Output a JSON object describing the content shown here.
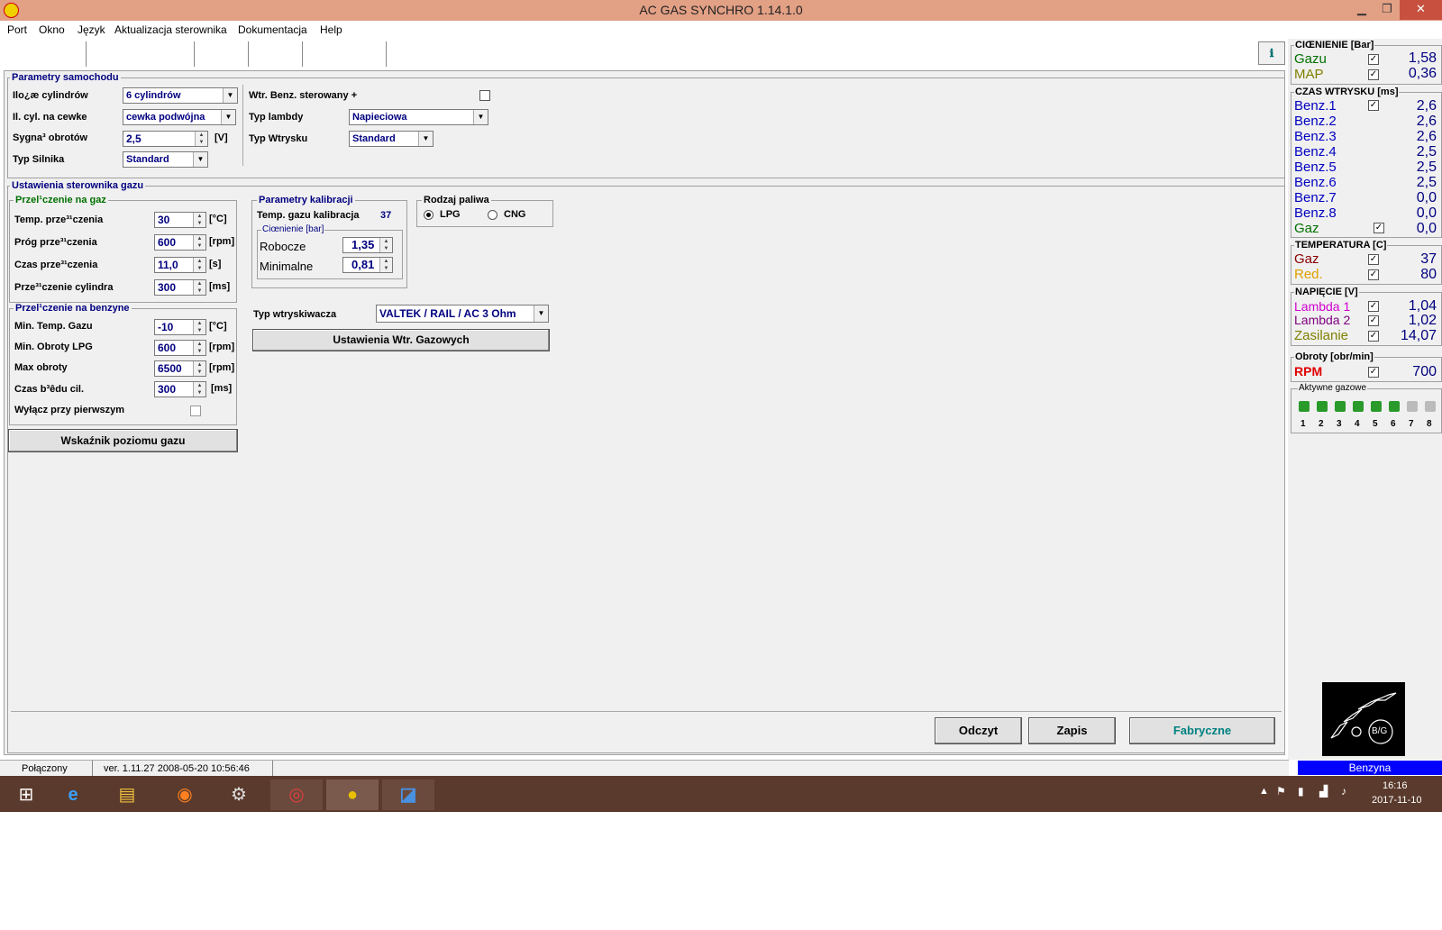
{
  "window": {
    "title": "AC GAS SYNCHRO     1.14.1.0",
    "minimize": "▁",
    "restore": "❐",
    "close": "✕"
  },
  "menu": [
    "Port",
    "Okno",
    "Język",
    "Aktualizacja sterownika",
    "Dokumentacja",
    "Help"
  ],
  "toolbar": {
    "help_icon": "ℹ"
  },
  "car_params": {
    "title": "Parametry samochodu",
    "cylinders_label": "Ilo¿æ cylindrów",
    "cylinders_value": "6 cylindrów",
    "coil_label": "Il. cyl. na cewke",
    "coil_value": "cewka podwójna",
    "rpm_signal_label": "Sygna³ obrotów",
    "rpm_signal_value": "2,5",
    "rpm_signal_unit": "[V]",
    "engine_label": "Typ Silnika",
    "engine_value": "Standard",
    "petrol_inj_label": "Wtr. Benz. sterowany +",
    "lambda_label": "Typ lambdy",
    "lambda_value": "Napieciowa",
    "injection_label": "Typ Wtrysku",
    "injection_value": "Standard"
  },
  "controller": {
    "title": "Ustawienia sterownika gazu",
    "to_gas": {
      "title": "Przel¹czenie na gaz",
      "rows": [
        {
          "label": "Temp. prze³¹czenia",
          "value": "30",
          "unit": "[°C]"
        },
        {
          "label": "Próg prze³¹czenia",
          "value": "600",
          "unit": "[rpm]"
        },
        {
          "label": "Czas prze³¹czenia",
          "value": "11,0",
          "unit": "[s]"
        },
        {
          "label": "Prze³¹czenie cylindra",
          "value": "300",
          "unit": "[ms]"
        }
      ]
    },
    "to_petrol": {
      "title": "Przel¹czenie na benzyne",
      "rows": [
        {
          "label": "Min. Temp. Gazu",
          "value": "-10",
          "unit": "[°C]"
        },
        {
          "label": "Min. Obroty LPG",
          "value": "600",
          "unit": "[rpm]"
        },
        {
          "label": "Max obroty",
          "value": "6500",
          "unit": "[rpm]"
        },
        {
          "label": "Czas b³êdu cil.",
          "value": "300",
          "unit": "[ms]"
        }
      ],
      "first_off_label": "Wyłącz przy pierwszym"
    },
    "gas_level_button": "Wskaźnik poziomu gazu",
    "calibration": {
      "title": "Parametry kalibracji",
      "temp_label": "Temp. gazu kalibracja",
      "temp_value": "37",
      "pressure_title": "Ciœnienie [bar]",
      "working_label": "Robocze",
      "working_value": "1,35",
      "min_label": "Minimalne",
      "min_value": "0,81"
    },
    "fuel": {
      "title": "Rodzaj paliwa",
      "lpg": "LPG",
      "cng": "CNG",
      "selected": "LPG"
    },
    "injector_label": "Typ wtryskiwacza",
    "injector_value": "VALTEK / RAIL / AC 3 Ohm",
    "injector_settings_button": "Ustawienia Wtr. Gazowych"
  },
  "buttons": {
    "read": "Odczyt",
    "write": "Zapis",
    "factory": "Fabryczne"
  },
  "monitor": {
    "pressure": {
      "title": "CIŒNIENIE [Bar]",
      "rows": [
        {
          "label": "Gazu",
          "value": "1,58",
          "color": "#007000"
        },
        {
          "label": "MAP",
          "value": "0,36",
          "color": "#808000"
        }
      ]
    },
    "injection": {
      "title": "CZAS WTRYSKU  [ms]",
      "rows": [
        {
          "label": "Benz.1",
          "value": "2,6",
          "color": "#0000c0",
          "check": true
        },
        {
          "label": "Benz.2",
          "value": "2,6",
          "color": "#0000c0",
          "check": false
        },
        {
          "label": "Benz.3",
          "value": "2,6",
          "color": "#0000c0",
          "check": false
        },
        {
          "label": "Benz.4",
          "value": "2,5",
          "color": "#0000c0",
          "check": false
        },
        {
          "label": "Benz.5",
          "value": "2,5",
          "color": "#0000c0",
          "check": false
        },
        {
          "label": "Benz.6",
          "value": "2,5",
          "color": "#0000c0",
          "check": false
        },
        {
          "label": "Benz.7",
          "value": "0,0",
          "color": "#0000c0",
          "check": false
        },
        {
          "label": "Benz.8",
          "value": "0,0",
          "color": "#0000c0",
          "check": false
        },
        {
          "label": "Gaz",
          "value": "0,0",
          "color": "#007000",
          "check": true
        }
      ]
    },
    "temperature": {
      "title": "TEMPERATURA  [C]",
      "rows": [
        {
          "label": "Gaz",
          "value": "37",
          "color": "#8b0000"
        },
        {
          "label": "Red.",
          "value": "80",
          "color": "#e0a000"
        }
      ]
    },
    "voltage": {
      "title": "NAPIĘCIE  [V]",
      "rows": [
        {
          "label": "Lambda 1",
          "value": "1,04",
          "color": "#d000d0"
        },
        {
          "label": "Lambda 2",
          "value": "1,02",
          "color": "#800080"
        },
        {
          "label": "Zasilanie",
          "value": "14,07",
          "color": "#808000"
        }
      ]
    },
    "rpm": {
      "title": "Obroty [obr/min]",
      "label": "RPM",
      "value": "700",
      "color": "#e00000"
    },
    "active": {
      "title": "Aktywne gazowe",
      "numbers": [
        "1",
        "2",
        "3",
        "4",
        "5",
        "6",
        "7",
        "8"
      ]
    },
    "logo_text": "B/G",
    "fuel_status": "Benzyna"
  },
  "status": {
    "connection": "Połączony",
    "version": "ver. 1.11.27  2008-05-20  10:56:46"
  },
  "tray": {
    "time": "16:16",
    "date": "2017-11-10"
  }
}
